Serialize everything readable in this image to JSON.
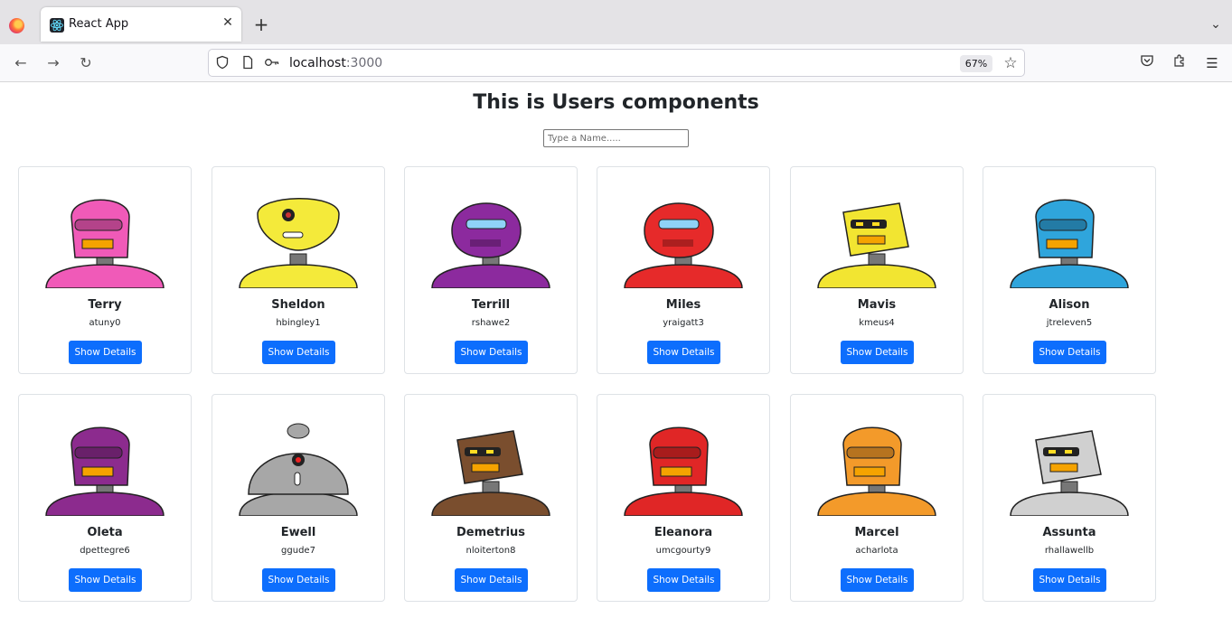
{
  "browser": {
    "tab_title": "React App",
    "url_host": "localhost",
    "url_port": ":3000",
    "zoom": "67%"
  },
  "page": {
    "heading": "This is Users components",
    "search_placeholder": "Type a Name....."
  },
  "button_label": "Show Details",
  "users": [
    {
      "name": "Terry",
      "username": "atuny0",
      "color": "#f05ab8",
      "head": "tall"
    },
    {
      "name": "Sheldon",
      "username": "hbingley1",
      "color": "#f4ea3a",
      "head": "wide"
    },
    {
      "name": "Terrill",
      "username": "rshawe2",
      "color": "#8c2a9e",
      "head": "round"
    },
    {
      "name": "Miles",
      "username": "yraigatt3",
      "color": "#e62a2a",
      "head": "round"
    },
    {
      "name": "Mavis",
      "username": "kmeus4",
      "color": "#f2e531",
      "head": "box"
    },
    {
      "name": "Alison",
      "username": "jtreleven5",
      "color": "#2fa5dc",
      "head": "tall"
    },
    {
      "name": "Oleta",
      "username": "dpettegre6",
      "color": "#8c2b8e",
      "head": "tall"
    },
    {
      "name": "Ewell",
      "username": "ggude7",
      "color": "#a7a7a7",
      "head": "dome"
    },
    {
      "name": "Demetrius",
      "username": "nloiterton8",
      "color": "#7a4e2e",
      "head": "box"
    },
    {
      "name": "Eleanora",
      "username": "umcgourty9",
      "color": "#e02626",
      "head": "tall"
    },
    {
      "name": "Marcel",
      "username": "acharlota",
      "color": "#f39a2a",
      "head": "tall"
    },
    {
      "name": "Assunta",
      "username": "rhallawellb",
      "color": "#d0d0d0",
      "head": "box"
    }
  ]
}
